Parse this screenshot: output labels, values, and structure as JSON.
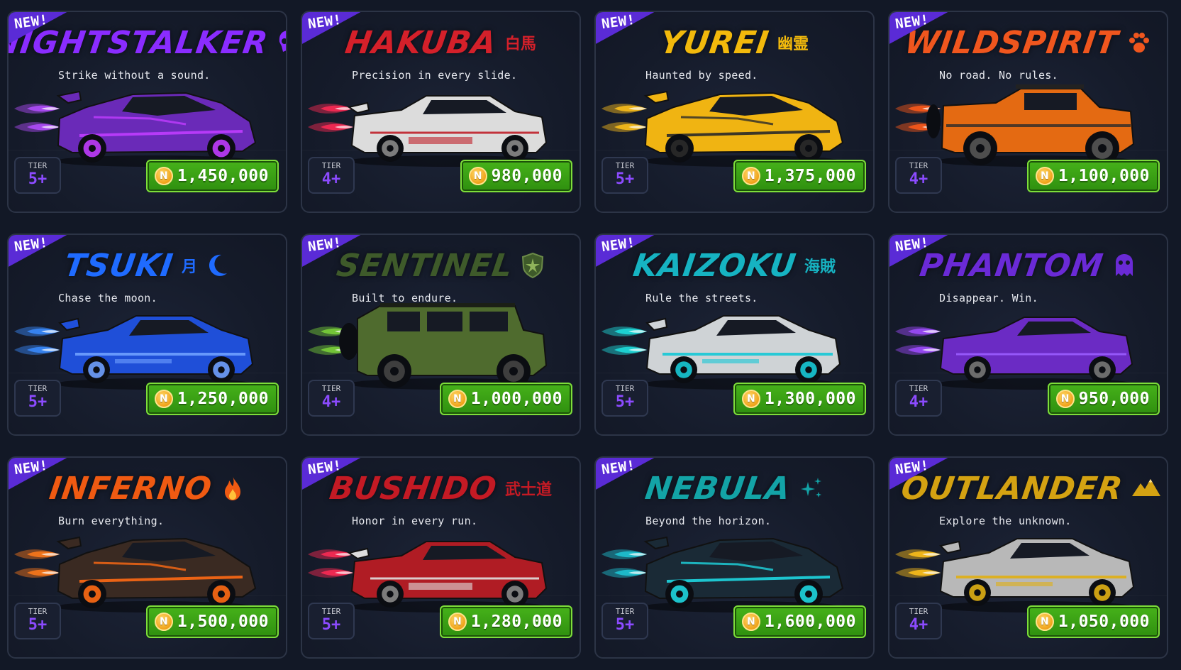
{
  "tier_label": "TIER",
  "new_badge": "NEW!",
  "coin_symbol": "N",
  "cars": [
    {
      "name": "NIGHTSTALKER",
      "kanji": "",
      "emblem": "skull-icon",
      "tagline": "Strike without a sound.",
      "tier": "5+",
      "price": "1,450,000",
      "name_color": "#8a2cff",
      "body_color": "#6a2ab8",
      "accent_color": "#c03cff",
      "exhaust_color": "#b34dff",
      "style": "supercar"
    },
    {
      "name": "HAKUBA",
      "kanji": "白馬",
      "emblem": "",
      "tagline": "Precision in every slide.",
      "tier": "4+",
      "price": "980,000",
      "name_color": "#d4202a",
      "body_color": "#dcdcdc",
      "accent_color": "#c0202a",
      "exhaust_color": "#ff2a55",
      "style": "coupe"
    },
    {
      "name": "YUREI",
      "kanji": "幽霊",
      "emblem": "",
      "tagline": "Haunted by speed.",
      "tier": "5+",
      "price": "1,375,000",
      "name_color": "#f2b90c",
      "body_color": "#f0b412",
      "accent_color": "#2a2a2a",
      "exhaust_color": "#ffc21a",
      "style": "supercar"
    },
    {
      "name": "WILDSPIRIT",
      "kanji": "",
      "emblem": "paw-icon",
      "tagline": "No road. No rules.",
      "tier": "4+",
      "price": "1,100,000",
      "name_color": "#f0561e",
      "body_color": "#e46a12",
      "accent_color": "#2b2b2b",
      "exhaust_color": "#ff5a1a",
      "style": "truck"
    },
    {
      "name": "TSUKI",
      "kanji": "月",
      "emblem": "moon-icon",
      "tagline": "Chase the moon.",
      "tier": "5+",
      "price": "1,250,000",
      "name_color": "#1f6bff",
      "body_color": "#1f4fd8",
      "accent_color": "#6fa0ff",
      "exhaust_color": "#3a8cff",
      "style": "gt"
    },
    {
      "name": "SENTINEL",
      "kanji": "",
      "emblem": "shield-icon",
      "tagline": "Built to endure.",
      "tier": "4+",
      "price": "1,000,000",
      "name_color": "#3e5a2a",
      "body_color": "#4f6b2e",
      "accent_color": "#2a3a1a",
      "exhaust_color": "#7bd43a",
      "style": "jeep"
    },
    {
      "name": "KAIZOKU",
      "kanji": "海賊",
      "emblem": "",
      "tagline": "Rule the streets.",
      "tier": "5+",
      "price": "1,300,000",
      "name_color": "#16b3c2",
      "body_color": "#cfd3d6",
      "accent_color": "#17c9d6",
      "exhaust_color": "#1ee0e0",
      "style": "gt"
    },
    {
      "name": "PHANTOM",
      "kanji": "",
      "emblem": "ghost-icon",
      "tagline": "Disappear. Win.",
      "tier": "4+",
      "price": "950,000",
      "name_color": "#6a2ad6",
      "body_color": "#6b2bc4",
      "accent_color": "#9a5cff",
      "exhaust_color": "#a04cff",
      "style": "muscle"
    },
    {
      "name": "INFERNO",
      "kanji": "",
      "emblem": "flame-icon",
      "tagline": "Burn everything.",
      "tier": "5+",
      "price": "1,500,000",
      "name_color": "#f05a12",
      "body_color": "#3a2a22",
      "accent_color": "#ff6a14",
      "exhaust_color": "#ff7a1a",
      "style": "supercar"
    },
    {
      "name": "BUSHIDO",
      "kanji": "武士道",
      "emblem": "",
      "tagline": "Honor in every run.",
      "tier": "5+",
      "price": "1,280,000",
      "name_color": "#c41a24",
      "body_color": "#b01c24",
      "accent_color": "#e0e0e0",
      "exhaust_color": "#ff2a55",
      "style": "coupe"
    },
    {
      "name": "NEBULA",
      "kanji": "",
      "emblem": "sparkle-icon",
      "tagline": "Beyond the horizon.",
      "tier": "5+",
      "price": "1,600,000",
      "name_color": "#13a3a6",
      "body_color": "#1a2a36",
      "accent_color": "#1ed6e0",
      "exhaust_color": "#1ec8d6",
      "style": "supercar"
    },
    {
      "name": "OUTLANDER",
      "kanji": "",
      "emblem": "mountain-icon",
      "tagline": "Explore the unknown.",
      "tier": "4+",
      "price": "1,050,000",
      "name_color": "#d4a212",
      "body_color": "#b8b8b8",
      "accent_color": "#e0b014",
      "exhaust_color": "#ffc21a",
      "style": "gt"
    }
  ]
}
